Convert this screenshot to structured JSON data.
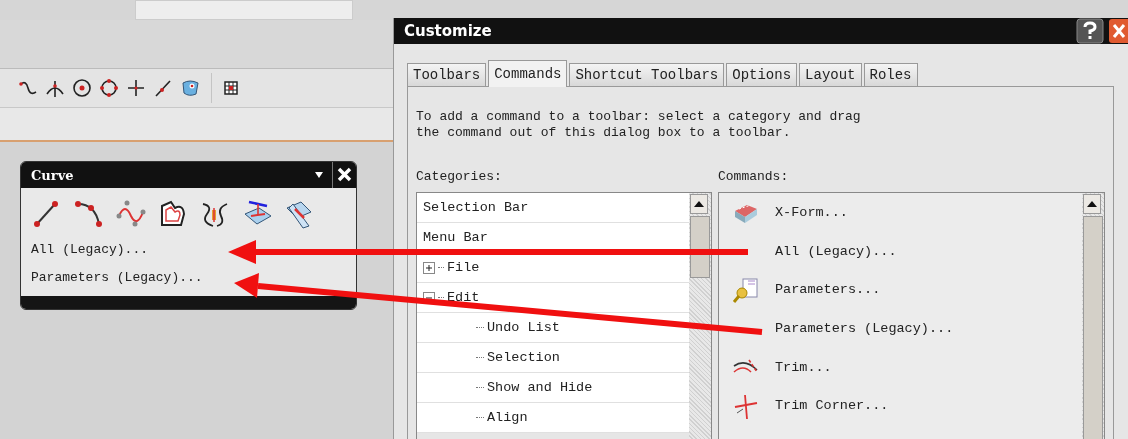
{
  "curve_toolbar": {
    "title": "Curve",
    "items": [
      "All (Legacy)...",
      "Parameters (Legacy)..."
    ]
  },
  "dialog": {
    "title": "Customize",
    "tabs": [
      {
        "label": "Toolbars",
        "selected": false
      },
      {
        "label": "Commands",
        "selected": true
      },
      {
        "label": "Shortcut Toolbars",
        "selected": false
      },
      {
        "label": "Options",
        "selected": false
      },
      {
        "label": "Layout",
        "selected": false
      },
      {
        "label": "Roles",
        "selected": false
      }
    ],
    "instruction": "To add a command to a toolbar: select a category and drag\nthe command out of this dialog box to a toolbar.",
    "categories_label": "Categories:",
    "categories": [
      {
        "label": "Selection Bar"
      },
      {
        "label": "Menu Bar"
      },
      {
        "label": "File",
        "expanded": false
      },
      {
        "label": "Edit",
        "expanded": true,
        "children": [
          {
            "label": "Undo List"
          },
          {
            "label": "Selection"
          },
          {
            "label": "Show and Hide"
          },
          {
            "label": "Align"
          }
        ]
      }
    ],
    "commands_label": "Commands:",
    "commands": [
      {
        "label": "X-Form...",
        "kind": "xform"
      },
      {
        "label": "All (Legacy)...",
        "kind": "plain"
      },
      {
        "label": "Parameters...",
        "kind": "params"
      },
      {
        "label": "Parameters (Legacy)...",
        "kind": "plain"
      },
      {
        "label": "Trim...",
        "kind": "trim"
      },
      {
        "label": "Trim Corner...",
        "kind": "corner"
      }
    ]
  }
}
